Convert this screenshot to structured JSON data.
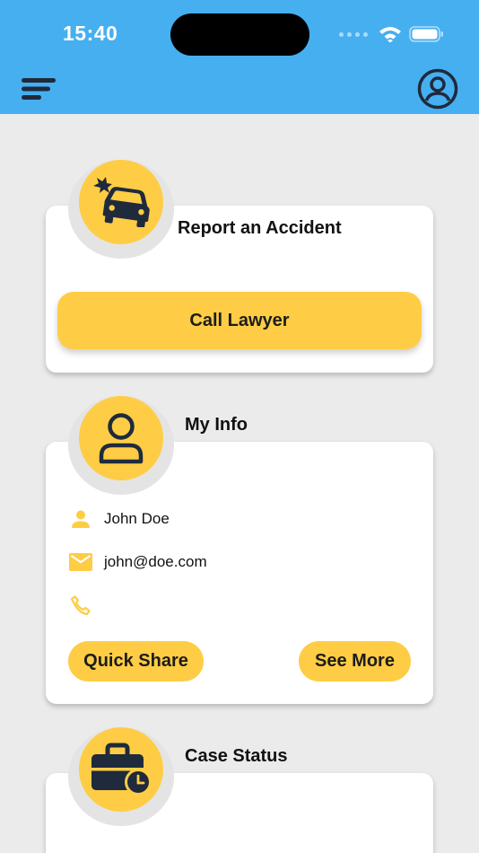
{
  "status_bar": {
    "time": "15:40"
  },
  "colors": {
    "header": "#45aff0",
    "accent": "#fecd45",
    "background": "#ebebeb",
    "icon_dark": "#1f2a3c"
  },
  "header": {
    "menu_icon": "menu-lines-icon",
    "profile_icon": "user-circle-icon"
  },
  "cards": {
    "accident": {
      "title": "Report an Accident",
      "icon": "car-crash-icon",
      "button_label": "Call Lawyer"
    },
    "info": {
      "title": "My Info",
      "icon": "person-outline-icon",
      "name": "John Doe",
      "email": "john@doe.com",
      "phone": "",
      "quick_share_label": "Quick Share",
      "see_more_label": "See More"
    },
    "case_status": {
      "title": "Case Status",
      "icon": "briefcase-clock-icon"
    }
  }
}
